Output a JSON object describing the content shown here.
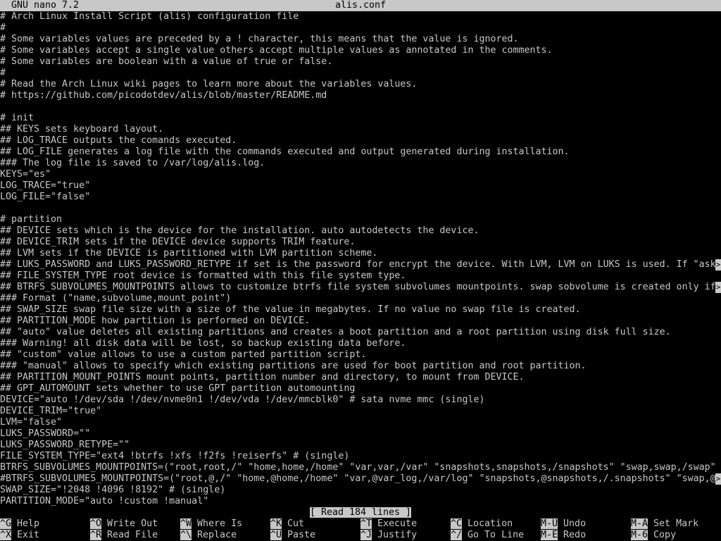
{
  "titlebar": {
    "app": "GNU nano 7.2",
    "file": "alis.conf"
  },
  "lines": [
    {
      "text": "# Arch Linux Install Script (alis) configuration file",
      "more": false
    },
    {
      "text": "#",
      "more": false
    },
    {
      "text": "# Some variables values are preceded by a ! character, this means that the value is ignored.",
      "more": false
    },
    {
      "text": "# Some variables accept a single value others accept multiple values as annotated in the comments.",
      "more": false
    },
    {
      "text": "# Some variables are boolean with a value of true or false.",
      "more": false
    },
    {
      "text": "#",
      "more": false
    },
    {
      "text": "# Read the Arch Linux wiki pages to learn more about the variables values.",
      "more": false
    },
    {
      "text": "# https://github.com/picodotdev/alis/blob/master/README.md",
      "more": false
    },
    {
      "text": "",
      "more": false
    },
    {
      "text": "# init",
      "more": false
    },
    {
      "text": "## KEYS sets keyboard layout.",
      "more": false
    },
    {
      "text": "## LOG_TRACE outputs the comands executed.",
      "more": false
    },
    {
      "text": "## LOG_FILE generates a log file with the commands executed and output generated during installation.",
      "more": false
    },
    {
      "text": "### The log file is saved to /var/log/alis.log.",
      "more": false
    },
    {
      "text": "KEYS=\"es\"",
      "more": false
    },
    {
      "text": "LOG_TRACE=\"true\"",
      "more": false
    },
    {
      "text": "LOG_FILE=\"false\"",
      "more": false
    },
    {
      "text": "",
      "more": false
    },
    {
      "text": "# partition",
      "more": false
    },
    {
      "text": "## DEVICE sets which is the device for the installation. auto autodetects the device.",
      "more": false
    },
    {
      "text": "## DEVICE_TRIM sets if the DEVICE device supports TRIM feature.",
      "more": false
    },
    {
      "text": "## LVM sets if the DEVICE is partitioned with LVM partition scheme.",
      "more": false
    },
    {
      "text": "## LUKS_PASSWORD and LUKS_PASSWORD_RETYPE if set is the password for encrypt the device. With LVM, LVM on LUKS is used. If \"ask",
      "more": true
    },
    {
      "text": "## FILE_SYSTEM_TYPE root device is formatted with this file system type.",
      "more": false
    },
    {
      "text": "## BTRFS_SUBVOLUMES_MOUNTPOINTS allows to customize btrfs file system subvolumes mountpoints. swap sobvolume is created only if",
      "more": true
    },
    {
      "text": "### Format (\"name,subvolume,mount_point\")",
      "more": false
    },
    {
      "text": "## SWAP_SIZE swap file size with a size of the value in megabytes. If no value no swap file is created.",
      "more": false
    },
    {
      "text": "## PARTITION_MODE how partition is performed on DEVICE.",
      "more": false
    },
    {
      "text": "## \"auto\" value deletes all existing partitions and creates a boot partition and a root partition using disk full size.",
      "more": false
    },
    {
      "text": "### Warning! all disk data will be lost, so backup existing data before.",
      "more": false
    },
    {
      "text": "## \"custom\" value allows to use a custom parted partition script.",
      "more": false
    },
    {
      "text": "### \"manual\" allows to specify which existing partitions are used for boot partition and root partition.",
      "more": false
    },
    {
      "text": "## PARTITION_MOUNT_POINTS mount points, partition number and directory, to mount from DEVICE.",
      "more": false
    },
    {
      "text": "## GPT_AUTOMOUNT sets whether to use GPT partition automounting",
      "more": false
    },
    {
      "text": "DEVICE=\"auto !/dev/sda !/dev/nvme0n1 !/dev/vda !/dev/mmcblk0\" # sata nvme mmc (single)",
      "more": false
    },
    {
      "text": "DEVICE_TRIM=\"true\"",
      "more": false
    },
    {
      "text": "LVM=\"false\"",
      "more": false
    },
    {
      "text": "LUKS_PASSWORD=\"\"",
      "more": false
    },
    {
      "text": "LUKS_PASSWORD_RETYPE=\"\"",
      "more": false
    },
    {
      "text": "FILE_SYSTEM_TYPE=\"ext4 !btrfs !xfs !f2fs !reiserfs\" # (single)",
      "more": false
    },
    {
      "text": "BTRFS_SUBVOLUMES_MOUNTPOINTS=(\"root,root,/\" \"home,home,/home\" \"var,var,/var\" \"snapshots,snapshots,/snapshots\" \"swap,swap,/swap\")",
      "more": false
    },
    {
      "text": "#BTRFS_SUBVOLUMES_MOUNTPOINTS=(\"root,@,/\" \"home,@home,/home\" \"var,@var_log,/var/log\" \"snapshots,@snapshots,/.snapshots\" \"swap,@",
      "more": true
    },
    {
      "text": "SWAP_SIZE=\"!2048 !4096 !8192\" # (single)",
      "more": false
    },
    {
      "text": "PARTITION_MODE=\"auto !custom !manual\"",
      "more": false
    }
  ],
  "status": "[ Read 184 lines ]",
  "shortcuts": [
    {
      "key": "^G",
      "label": "Help"
    },
    {
      "key": "^X",
      "label": "Exit"
    },
    {
      "key": "^O",
      "label": "Write Out"
    },
    {
      "key": "^R",
      "label": "Read File"
    },
    {
      "key": "^W",
      "label": "Where Is"
    },
    {
      "key": "^\\",
      "label": "Replace"
    },
    {
      "key": "^K",
      "label": "Cut"
    },
    {
      "key": "^U",
      "label": "Paste"
    },
    {
      "key": "^T",
      "label": "Execute"
    },
    {
      "key": "^J",
      "label": "Justify"
    },
    {
      "key": "^C",
      "label": "Location"
    },
    {
      "key": "^/",
      "label": "Go To Line"
    },
    {
      "key": "M-U",
      "label": "Undo"
    },
    {
      "key": "M-E",
      "label": "Redo"
    },
    {
      "key": "M-A",
      "label": "Set Mark"
    },
    {
      "key": "M-6",
      "label": "Copy"
    }
  ]
}
